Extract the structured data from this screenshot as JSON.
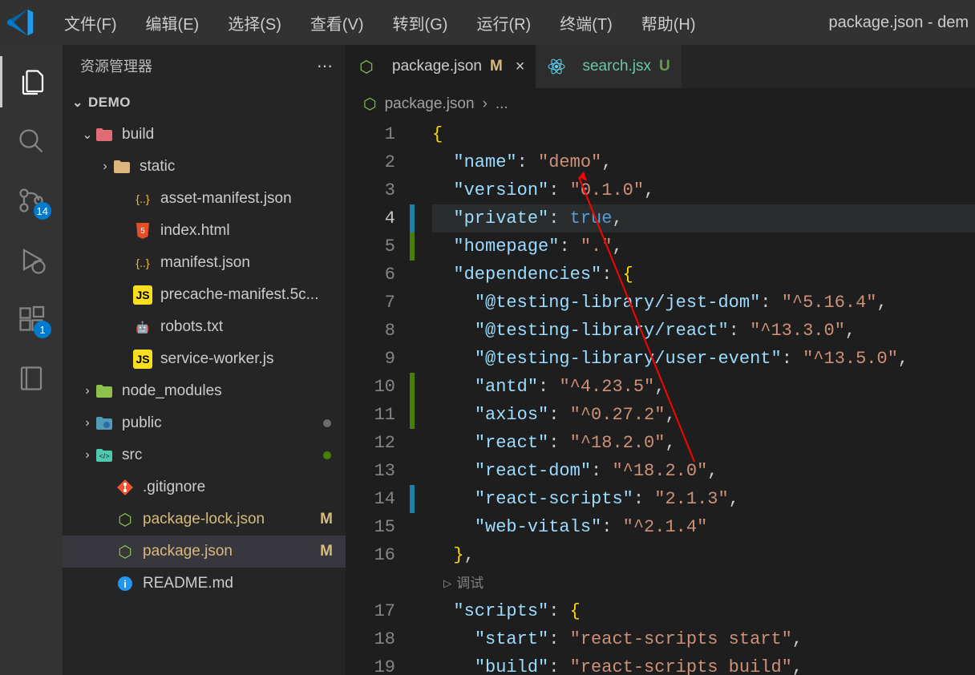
{
  "window_title": "package.json - dem",
  "menu": [
    "文件(F)",
    "编辑(E)",
    "选择(S)",
    "查看(V)",
    "转到(G)",
    "运行(R)",
    "终端(T)",
    "帮助(H)"
  ],
  "activity": {
    "scm_badge": "14",
    "ext_badge": "1"
  },
  "sidebar": {
    "title": "资源管理器",
    "folder": "DEMO",
    "tree": [
      {
        "indent": 1,
        "chev": "open",
        "icon": "folder-red",
        "label": "build"
      },
      {
        "indent": 2,
        "chev": "closed",
        "icon": "folder-yellow",
        "label": "static"
      },
      {
        "indent": 3,
        "chev": "",
        "icon": "json-br",
        "label": "asset-manifest.json"
      },
      {
        "indent": 3,
        "chev": "",
        "icon": "html5",
        "label": "index.html"
      },
      {
        "indent": 3,
        "chev": "",
        "icon": "json-br",
        "label": "manifest.json"
      },
      {
        "indent": 3,
        "chev": "",
        "icon": "js",
        "label": "precache-manifest.5c..."
      },
      {
        "indent": 3,
        "chev": "",
        "icon": "robot",
        "label": "robots.txt"
      },
      {
        "indent": 3,
        "chev": "",
        "icon": "js",
        "label": "service-worker.js"
      },
      {
        "indent": 1,
        "chev": "closed",
        "icon": "folder-green",
        "label": "node_modules"
      },
      {
        "indent": 1,
        "chev": "closed",
        "icon": "folder-blue",
        "label": "public",
        "dot": "#6c6c6c"
      },
      {
        "indent": 1,
        "chev": "closed",
        "icon": "folder-src",
        "label": "src",
        "dot": "#487e02"
      },
      {
        "indent": 2,
        "chev": "",
        "icon": "git",
        "label": ".gitignore"
      },
      {
        "indent": 2,
        "chev": "",
        "icon": "nodejs",
        "label": "package-lock.json",
        "status": "M",
        "modified": true
      },
      {
        "indent": 2,
        "chev": "",
        "icon": "nodejs",
        "label": "package.json",
        "status": "M",
        "modified": true,
        "selected": true
      },
      {
        "indent": 2,
        "chev": "",
        "icon": "info",
        "label": "README.md"
      }
    ]
  },
  "tabs": [
    {
      "icon": "nodejs",
      "label": "package.json",
      "status": "M",
      "active": true,
      "closable": true
    },
    {
      "icon": "react",
      "label": "search.jsx",
      "status": "U",
      "status_class": "tab-u",
      "color": "#6cc7a6"
    }
  ],
  "breadcrumb": {
    "file": "package.json",
    "sep": "›",
    "more": "..."
  },
  "inline_debug": "调试",
  "code": {
    "active_line": 4,
    "gutter_marks": {
      "4": "modified",
      "5": "added",
      "10": "added",
      "11": "added",
      "14": "modified"
    },
    "lines": [
      {
        "n": 1,
        "tokens": [
          {
            "c": "s-brace",
            "t": "{"
          }
        ]
      },
      {
        "n": 2,
        "tokens": [
          {
            "c": "",
            "t": "  "
          },
          {
            "c": "s-key",
            "t": "\"name\""
          },
          {
            "c": "s-punc",
            "t": ": "
          },
          {
            "c": "s-str",
            "t": "\"demo\""
          },
          {
            "c": "s-punc",
            "t": ","
          }
        ]
      },
      {
        "n": 3,
        "tokens": [
          {
            "c": "",
            "t": "  "
          },
          {
            "c": "s-key",
            "t": "\"version\""
          },
          {
            "c": "s-punc",
            "t": ": "
          },
          {
            "c": "s-str",
            "t": "\"0.1.0\""
          },
          {
            "c": "s-punc",
            "t": ","
          }
        ]
      },
      {
        "n": 4,
        "hl": true,
        "tokens": [
          {
            "c": "",
            "t": "  "
          },
          {
            "c": "s-key",
            "t": "\"private\""
          },
          {
            "c": "s-punc",
            "t": ": "
          },
          {
            "c": "s-const",
            "t": "true"
          },
          {
            "c": "s-punc",
            "t": ","
          }
        ]
      },
      {
        "n": 5,
        "tokens": [
          {
            "c": "",
            "t": "  "
          },
          {
            "c": "s-key",
            "t": "\"homepage\""
          },
          {
            "c": "s-punc",
            "t": ": "
          },
          {
            "c": "s-str",
            "t": "\".\""
          },
          {
            "c": "s-punc",
            "t": ","
          }
        ]
      },
      {
        "n": 6,
        "tokens": [
          {
            "c": "",
            "t": "  "
          },
          {
            "c": "s-key",
            "t": "\"dependencies\""
          },
          {
            "c": "s-punc",
            "t": ": "
          },
          {
            "c": "s-brace",
            "t": "{"
          }
        ]
      },
      {
        "n": 7,
        "tokens": [
          {
            "c": "",
            "t": "    "
          },
          {
            "c": "s-key",
            "t": "\"@testing-library/jest-dom\""
          },
          {
            "c": "s-punc",
            "t": ": "
          },
          {
            "c": "s-str",
            "t": "\"^5.16.4\""
          },
          {
            "c": "s-punc",
            "t": ","
          }
        ]
      },
      {
        "n": 8,
        "tokens": [
          {
            "c": "",
            "t": "    "
          },
          {
            "c": "s-key",
            "t": "\"@testing-library/react\""
          },
          {
            "c": "s-punc",
            "t": ": "
          },
          {
            "c": "s-str",
            "t": "\"^13.3.0\""
          },
          {
            "c": "s-punc",
            "t": ","
          }
        ]
      },
      {
        "n": 9,
        "tokens": [
          {
            "c": "",
            "t": "    "
          },
          {
            "c": "s-key",
            "t": "\"@testing-library/user-event\""
          },
          {
            "c": "s-punc",
            "t": ": "
          },
          {
            "c": "s-str",
            "t": "\"^13.5.0\""
          },
          {
            "c": "s-punc",
            "t": ","
          }
        ]
      },
      {
        "n": 10,
        "tokens": [
          {
            "c": "",
            "t": "    "
          },
          {
            "c": "s-key",
            "t": "\"antd\""
          },
          {
            "c": "s-punc",
            "t": ": "
          },
          {
            "c": "s-str",
            "t": "\"^4.23.5\""
          },
          {
            "c": "s-punc",
            "t": ","
          }
        ]
      },
      {
        "n": 11,
        "tokens": [
          {
            "c": "",
            "t": "    "
          },
          {
            "c": "s-key",
            "t": "\"axios\""
          },
          {
            "c": "s-punc",
            "t": ": "
          },
          {
            "c": "s-str",
            "t": "\"^0.27.2\""
          },
          {
            "c": "s-punc",
            "t": ","
          }
        ]
      },
      {
        "n": 12,
        "tokens": [
          {
            "c": "",
            "t": "    "
          },
          {
            "c": "s-key",
            "t": "\"react\""
          },
          {
            "c": "s-punc",
            "t": ": "
          },
          {
            "c": "s-str",
            "t": "\"^18.2.0\""
          },
          {
            "c": "s-punc",
            "t": ","
          }
        ]
      },
      {
        "n": 13,
        "tokens": [
          {
            "c": "",
            "t": "    "
          },
          {
            "c": "s-key",
            "t": "\"react-dom\""
          },
          {
            "c": "s-punc",
            "t": ": "
          },
          {
            "c": "s-str",
            "t": "\"^18.2.0\""
          },
          {
            "c": "s-punc",
            "t": ","
          }
        ]
      },
      {
        "n": 14,
        "tokens": [
          {
            "c": "",
            "t": "    "
          },
          {
            "c": "s-key",
            "t": "\"react-scripts\""
          },
          {
            "c": "s-punc",
            "t": ": "
          },
          {
            "c": "s-str",
            "t": "\"2.1.3\""
          },
          {
            "c": "s-punc",
            "t": ","
          }
        ]
      },
      {
        "n": 15,
        "tokens": [
          {
            "c": "",
            "t": "    "
          },
          {
            "c": "s-key",
            "t": "\"web-vitals\""
          },
          {
            "c": "s-punc",
            "t": ": "
          },
          {
            "c": "s-str",
            "t": "\"^2.1.4\""
          }
        ]
      },
      {
        "n": 16,
        "tokens": [
          {
            "c": "",
            "t": "  "
          },
          {
            "c": "s-brace",
            "t": "}"
          },
          {
            "c": "s-punc",
            "t": ","
          }
        ]
      },
      {
        "n": "debug",
        "inline_debug": true
      },
      {
        "n": 17,
        "tokens": [
          {
            "c": "",
            "t": "  "
          },
          {
            "c": "s-key",
            "t": "\"scripts\""
          },
          {
            "c": "s-punc",
            "t": ": "
          },
          {
            "c": "s-brace",
            "t": "{"
          }
        ]
      },
      {
        "n": 18,
        "tokens": [
          {
            "c": "",
            "t": "    "
          },
          {
            "c": "s-key",
            "t": "\"start\""
          },
          {
            "c": "s-punc",
            "t": ": "
          },
          {
            "c": "s-str",
            "t": "\"react-scripts start\""
          },
          {
            "c": "s-punc",
            "t": ","
          }
        ]
      },
      {
        "n": 19,
        "tokens": [
          {
            "c": "",
            "t": "    "
          },
          {
            "c": "s-key",
            "t": "\"build\""
          },
          {
            "c": "s-punc",
            "t": ": "
          },
          {
            "c": "s-str",
            "t": "\"react-scripts build\""
          },
          {
            "c": "s-punc",
            "t": ","
          }
        ]
      }
    ]
  }
}
